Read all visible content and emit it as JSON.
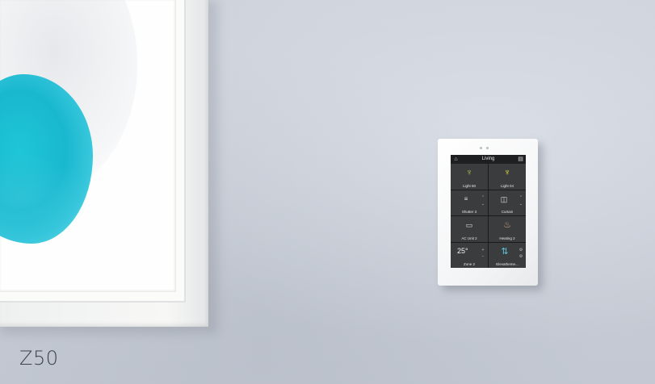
{
  "caption": "Z50",
  "panel": {
    "room_title": "Living",
    "tiles": [
      {
        "label": "Light 60"
      },
      {
        "label": "Light 04"
      },
      {
        "label": "Shutter 3"
      },
      {
        "label": "Curtain"
      },
      {
        "label": "AC Unit 2"
      },
      {
        "label": "Heating 2"
      },
      {
        "label": "Zone 2",
        "value": "25°"
      },
      {
        "label": "Elevatheme..."
      }
    ]
  },
  "colors": {
    "wall": "#c6cbd5",
    "blob": "#19b8cf",
    "screen": "#2f3133",
    "bulb_on": "#f2e53b"
  }
}
